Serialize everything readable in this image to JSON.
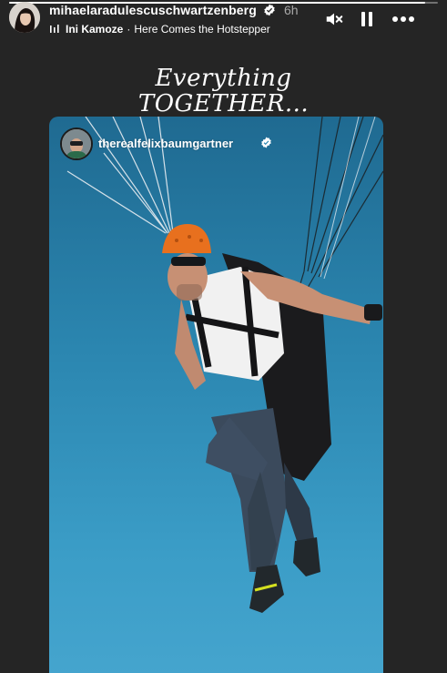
{
  "story": {
    "progress": 0.97,
    "username": "mihaelaradulescuschwartzenberg",
    "time": "6h",
    "music": {
      "artist": "Ini Kamoze",
      "separator": "·",
      "song": "Here Comes the Hotstepper"
    },
    "icons": {
      "verified": "verified-badge-icon",
      "music": "music-bars-icon",
      "mute": "speaker-muted-icon",
      "pause": "pause-icon",
      "more": "more-horizontal-icon"
    }
  },
  "caption": {
    "line1": "Everything",
    "line2": "TOGETHER..."
  },
  "shared_post": {
    "username": "therealfelixbaumgartner"
  },
  "colors": {
    "background": "#252525",
    "sky_top": "#1f6a91",
    "sky_bottom": "#47a6cf",
    "verified": "#ffffff",
    "helmet": "#e8701e"
  }
}
